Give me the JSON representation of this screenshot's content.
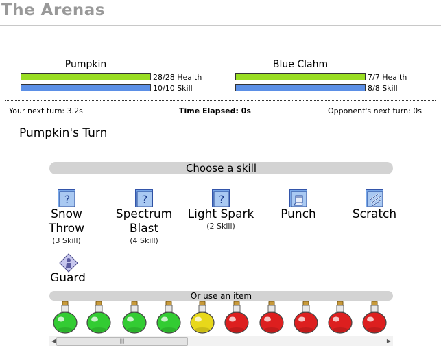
{
  "page": {
    "title": "The Arenas"
  },
  "player": {
    "name": "Pumpkin",
    "health_text": "28/28 Health",
    "skill_text": "10/10 Skill",
    "health_fraction": 1.0,
    "skill_fraction": 1.0
  },
  "opponent": {
    "name": "Blue Clahm",
    "health_text": "7/7 Health",
    "skill_text": "8/8 Skill",
    "health_fraction": 1.0,
    "skill_fraction": 1.0
  },
  "turn_info": {
    "your_next": "Your next turn: 3.2s",
    "elapsed": "Time Elapsed: 0s",
    "opponent_next": "Opponent's next turn: 0s"
  },
  "current_turn": "Pumpkin's Turn",
  "skills_header": "Choose a skill",
  "skills": [
    {
      "name_line1": "Snow",
      "name_line2": "Throw",
      "cost": "(3 Skill)",
      "icon": "question-mark-icon"
    },
    {
      "name_line1": "Spectrum",
      "name_line2": "Blast",
      "cost": "(4 Skill)",
      "icon": "question-mark-icon"
    },
    {
      "name_line1": "Light Spark",
      "name_line2": "",
      "cost": "(2 Skill)",
      "icon": "question-mark-icon"
    },
    {
      "name_line1": "Punch",
      "name_line2": "",
      "cost": "",
      "icon": "fist-icon"
    },
    {
      "name_line1": "Scratch",
      "name_line2": "",
      "cost": "",
      "icon": "claw-icon"
    },
    {
      "name_line1": "Guard",
      "name_line2": "",
      "cost": "",
      "icon": "guard-icon"
    }
  ],
  "items_header": "Or use an item",
  "items": [
    {
      "icon": "green-potion-icon",
      "color": "#33cc33"
    },
    {
      "icon": "green-potion-icon",
      "color": "#33cc33"
    },
    {
      "icon": "green-potion-icon",
      "color": "#33cc33"
    },
    {
      "icon": "green-potion-icon",
      "color": "#33cc33"
    },
    {
      "icon": "yellow-potion-icon",
      "color": "#e8d81a"
    },
    {
      "icon": "red-potion-icon",
      "color": "#dd1f1f"
    },
    {
      "icon": "red-potion-icon",
      "color": "#dd1f1f"
    },
    {
      "icon": "red-potion-icon",
      "color": "#dd1f1f"
    },
    {
      "icon": "red-potion-icon",
      "color": "#dd1f1f"
    },
    {
      "icon": "red-potion-icon",
      "color": "#dd1f1f"
    }
  ],
  "colors": {
    "health": "#99dd22",
    "skill": "#5b8fe6",
    "section_bar": "#d3d3d3",
    "title": "#999999"
  }
}
